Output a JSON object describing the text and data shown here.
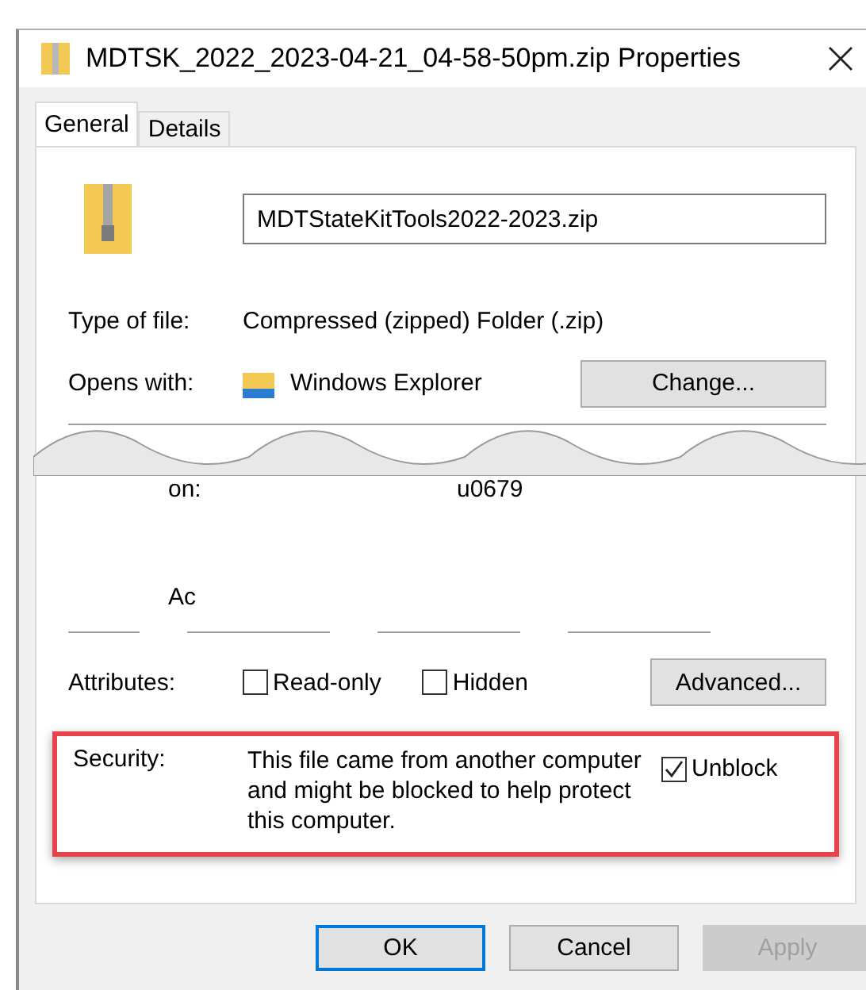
{
  "window": {
    "title": "MDTSK_2022_2023-04-21_04-58-50pm.zip Properties"
  },
  "tabs": [
    {
      "label": "General",
      "selected": true
    },
    {
      "label": "Details",
      "selected": false
    }
  ],
  "filename": {
    "value": "MDTStateKitTools2022-2023.zip"
  },
  "fields": [
    {
      "label": "Type of file:",
      "value": "Compressed (zipped) Folder (.zip)"
    },
    {
      "label": "Opens with:",
      "value": "Windows Explorer",
      "button": "Change..."
    }
  ],
  "fragments": [
    [
      "on:",
      "u0679"
    ],
    [
      "Ac"
    ]
  ],
  "attributes": {
    "label": "Attributes:",
    "options": [
      {
        "label": "Read-only",
        "checked": false
      },
      {
        "label": "Hidden",
        "checked": false
      }
    ],
    "button": "Advanced..."
  },
  "security": {
    "label": "Security:",
    "text": "This file came from another computer and might be blocked to help protect this computer.",
    "highlighted": true,
    "unblock": {
      "label": "Unblock",
      "checked": true
    }
  },
  "buttons": [
    {
      "label": "OK",
      "default": true,
      "disabled": false
    },
    {
      "label": "Cancel",
      "default": false,
      "disabled": false
    },
    {
      "label": "Apply",
      "default": false,
      "disabled": true
    }
  ]
}
